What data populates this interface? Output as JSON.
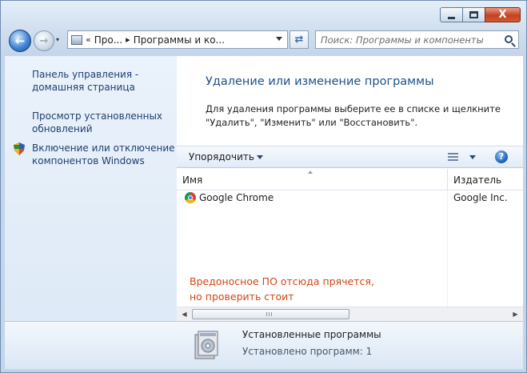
{
  "window": {
    "close_glyph": "X"
  },
  "nav": {
    "breadcrumb_prefix": "«",
    "crumbs": [
      "Про...",
      "Программы и ко..."
    ],
    "separator": "▸",
    "search_placeholder": "Поиск: Программы и компоненты"
  },
  "sidebar": {
    "items": [
      {
        "label": "Панель управления - домашняя страница"
      },
      {
        "label": "Просмотр установленных обновлений"
      },
      {
        "label": "Включение или отключение компонентов Windows"
      }
    ]
  },
  "main": {
    "title": "Удаление или изменение программы",
    "description": "Для удаления программы выберите ее в списке и щелкните \"Удалить\", \"Изменить\" или \"Восстановить\"."
  },
  "toolbar": {
    "organize_label": "Упорядочить",
    "help_glyph": "?"
  },
  "table": {
    "columns": [
      "Имя",
      "Издатель"
    ],
    "rows": [
      {
        "name": "Google Chrome",
        "publisher": "Google Inc."
      }
    ]
  },
  "annotation": {
    "line1": "Вредоносное ПО отсюда прячется,",
    "line2": "но проверить стоит"
  },
  "details": {
    "title": "Установленные программы",
    "count": "Установлено программ: 1"
  },
  "colors": {
    "accent_title": "#1e4f8a",
    "annotation": "#d14713"
  }
}
